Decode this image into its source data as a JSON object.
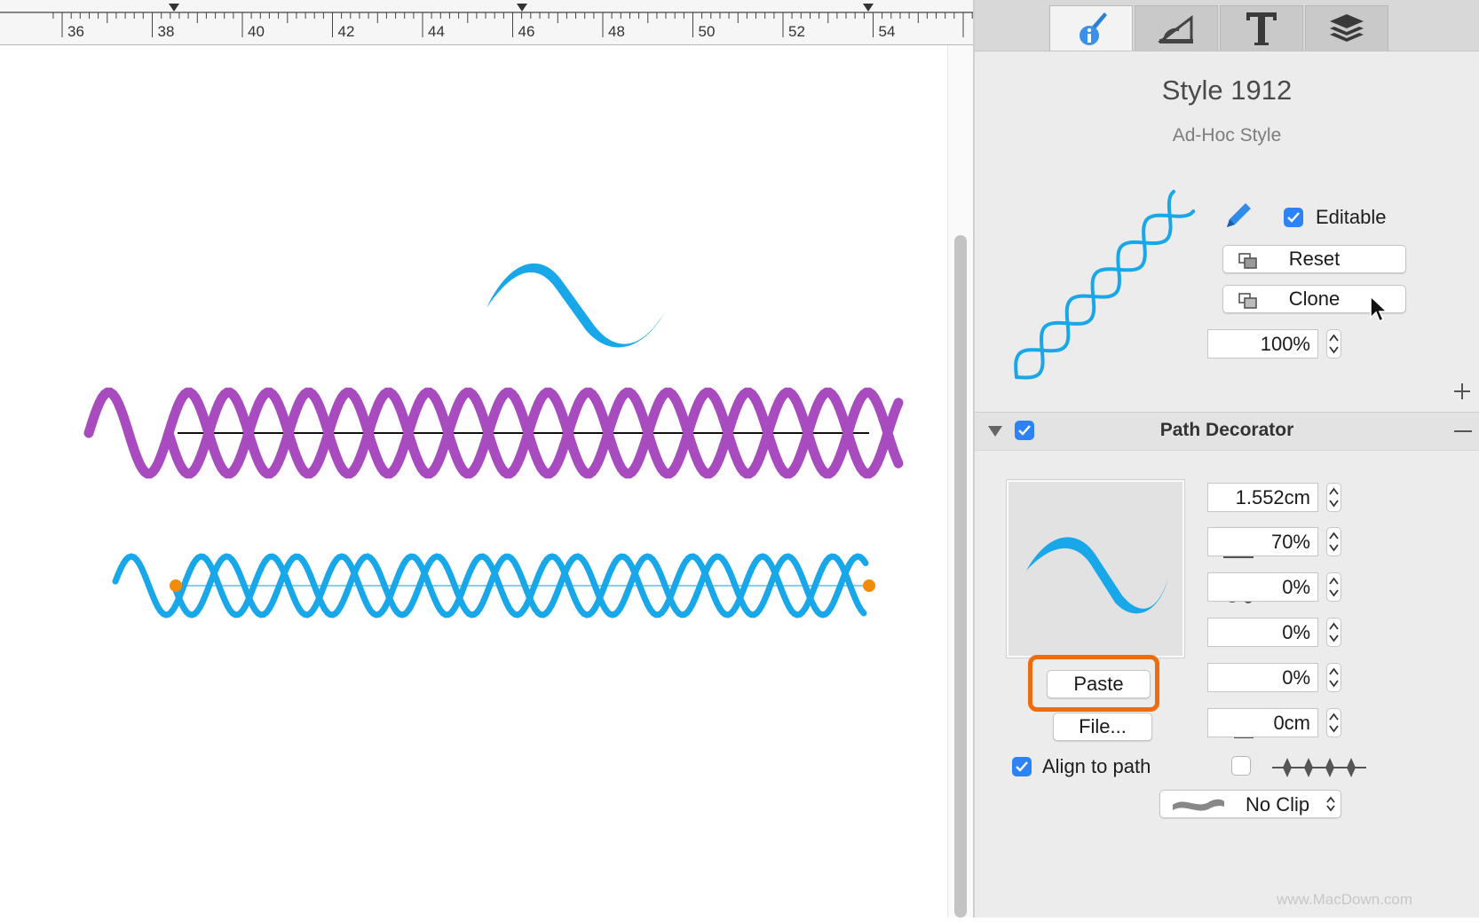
{
  "ruler": {
    "labels": [
      "36",
      "38",
      "40",
      "42",
      "44",
      "46",
      "48",
      "50",
      "52",
      "54"
    ]
  },
  "inspector": {
    "tabs": [
      {
        "name": "style-inspector",
        "icon": "brush-info-icon",
        "active": true
      },
      {
        "name": "geometry-inspector",
        "icon": "protractor-icon",
        "active": false
      },
      {
        "name": "text-inspector",
        "icon": "text-t-icon",
        "active": false
      },
      {
        "name": "layers-inspector",
        "icon": "layers-icon",
        "active": false
      }
    ],
    "style_name": "Style 1912",
    "style_kind": "Ad-Hoc Style",
    "editable_label": "Editable",
    "editable_checked": true,
    "reset_label": "Reset",
    "clone_label": "Clone",
    "opacity_value": "100%",
    "section": {
      "title": "Path Decorator",
      "expanded": true,
      "enabled": true,
      "paste_label": "Paste",
      "file_label": "File...",
      "align_label": "Align to path",
      "align_checked": true,
      "fields": [
        {
          "name": "spacing",
          "icon": "spacing-icon",
          "value": "1.552cm"
        },
        {
          "name": "scale",
          "icon": "scale-icon",
          "value": "70%"
        },
        {
          "name": "randomness",
          "icon": "random-dots-icon",
          "value": "0%"
        },
        {
          "name": "variation",
          "icon": "lines-icon",
          "value": "0%"
        },
        {
          "name": "taper",
          "icon": "taper-icon",
          "value": "0%"
        },
        {
          "name": "offset",
          "icon": "offset-squares-icon",
          "value": "0cm"
        }
      ],
      "stamp_checked": false,
      "clip_label": "No Clip"
    },
    "watermark": "www.MacDown.com"
  },
  "colors": {
    "accent": "#2d83f6",
    "cyan_stroke": "#18a7e8",
    "purple_stroke": "#a84bbf",
    "highlight": "#ef6c0c",
    "handle": "#f38b0a"
  }
}
